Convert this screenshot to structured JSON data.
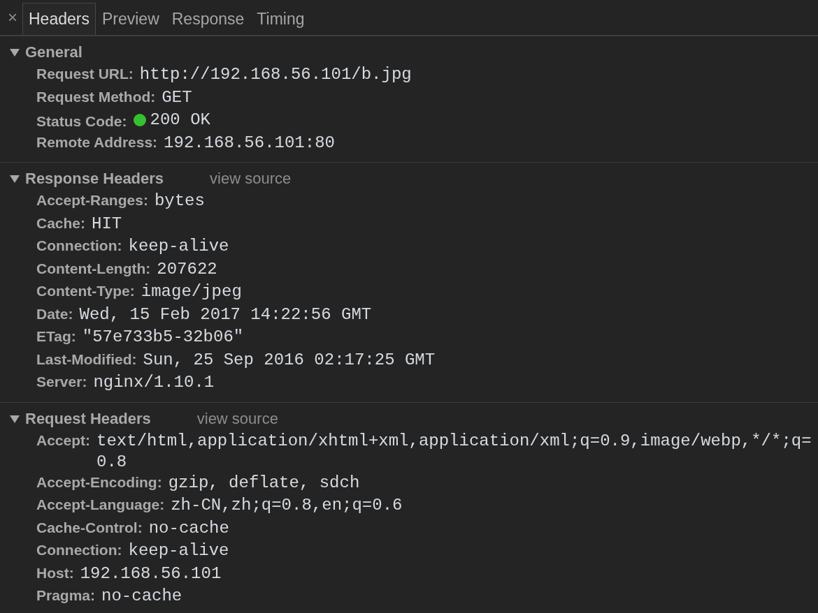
{
  "close_icon": "×",
  "tabs": [
    {
      "label": "Headers",
      "selected": true
    },
    {
      "label": "Preview",
      "selected": false
    },
    {
      "label": "Response",
      "selected": false
    },
    {
      "label": "Timing",
      "selected": false
    }
  ],
  "sections": [
    {
      "title": "General",
      "expanded": true,
      "headers": [
        {
          "name": "Request URL:",
          "value": "http://192.168.56.101/b.jpg"
        },
        {
          "name": "Request Method:",
          "value": "GET"
        },
        {
          "name": "Status Code:",
          "value": "200 OK",
          "color": "#35c12f"
        },
        {
          "name": "Remote Address:",
          "value": "192.168.56.101:80"
        }
      ]
    },
    {
      "title": "Response Headers",
      "link": "view source",
      "expanded": true,
      "headers": [
        {
          "name": "Accept-Ranges:",
          "value": "bytes"
        },
        {
          "name": "Cache:",
          "value": "HIT"
        },
        {
          "name": "Connection:",
          "value": "keep-alive"
        },
        {
          "name": "Content-Length:",
          "value": "207622"
        },
        {
          "name": "Content-Type:",
          "value": "image/jpeg"
        },
        {
          "name": "Date:",
          "value": "Wed, 15 Feb 2017 14:22:56 GMT"
        },
        {
          "name": "ETag:",
          "value": "\"57e733b5-32b06\""
        },
        {
          "name": "Last-Modified:",
          "value": "Sun, 25 Sep 2016 02:17:25 GMT"
        },
        {
          "name": "Server:",
          "value": "nginx/1.10.1"
        }
      ]
    },
    {
      "title": "Request Headers",
      "link": "view source",
      "expanded": true,
      "headers": [
        {
          "name": "Accept:",
          "value": "text/html,application/xhtml+xml,application/xml;q=0.9,image/webp,*/*;q=0.8"
        },
        {
          "name": "Accept-Encoding:",
          "value": "gzip, deflate, sdch"
        },
        {
          "name": "Accept-Language:",
          "value": "zh-CN,zh;q=0.8,en;q=0.6"
        },
        {
          "name": "Cache-Control:",
          "value": "no-cache"
        },
        {
          "name": "Connection:",
          "value": "keep-alive"
        },
        {
          "name": "Host:",
          "value": "192.168.56.101"
        },
        {
          "name": "Pragma:",
          "value": "no-cache"
        }
      ]
    }
  ]
}
